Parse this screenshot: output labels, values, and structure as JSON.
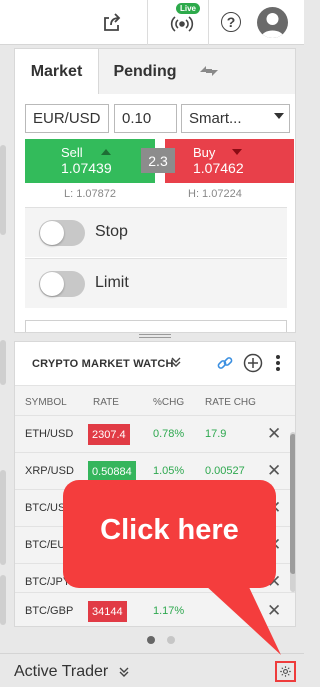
{
  "topbar": {
    "live_badge": "Live",
    "help_glyph": "?"
  },
  "order_ticket": {
    "tabs": [
      {
        "label": "Market"
      },
      {
        "label": "Pending"
      }
    ],
    "instrument": "EUR/USD",
    "quantity": "0.10",
    "order_type": "Smart...",
    "sell": {
      "label": "Sell",
      "price": "1.07439"
    },
    "buy": {
      "label": "Buy",
      "price": "1.07462"
    },
    "spread": "2.3",
    "low": "L: 1.07872",
    "high": "H: 1.07224",
    "stop_label": "Stop",
    "limit_label": "Limit"
  },
  "watch": {
    "title": "CRYPTO MARKET WATCH",
    "columns": [
      "SYMBOL",
      "RATE",
      "%CHG",
      "RATE CHG"
    ],
    "rows": [
      {
        "symbol": "ETH/USD",
        "rate": "2307.4",
        "direction": "down",
        "pct": "0.78%",
        "chg": "17.9"
      },
      {
        "symbol": "XRP/USD",
        "rate": "0.50884",
        "direction": "up",
        "pct": "1.05%",
        "chg": "0.00527"
      },
      {
        "symbol": "BTC/US",
        "rate": "",
        "direction": "",
        "pct": "",
        "chg": ""
      },
      {
        "symbol": "BTC/EU",
        "rate": "",
        "direction": "",
        "pct": "",
        "chg": ""
      },
      {
        "symbol": "BTC/JPY",
        "rate": "",
        "direction": "",
        "pct": "",
        "chg": ""
      },
      {
        "symbol": "BTC/GBP",
        "rate": "34144",
        "direction": "down",
        "pct": "1.17%",
        "chg": ""
      }
    ],
    "remove_glyph": "✕",
    "page_count": 2,
    "active_page": 1
  },
  "footer": {
    "title": "Active Trader"
  },
  "callout": {
    "text": "Click here"
  },
  "colors": {
    "sell": "#33bb5b",
    "buy": "#e8404a",
    "callout": "#f43d3d",
    "live": "#2daa4b"
  }
}
